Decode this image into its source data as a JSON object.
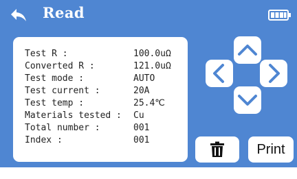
{
  "header": {
    "title": "Read",
    "back_icon": "back-arrow-icon",
    "battery_icon": "battery-full-icon"
  },
  "colors": {
    "header_bg": "#4f86d2",
    "accent": "#4f86d2",
    "panel_bg": "#ffffff",
    "text": "#222222"
  },
  "readings": [
    {
      "label": "Test R :",
      "value": "100.0uΩ"
    },
    {
      "label": "Converted R :",
      "value": "121.0uΩ"
    },
    {
      "label": "Test mode :",
      "value": "AUTO"
    },
    {
      "label": "Test current :",
      "value": "20A"
    },
    {
      "label": "Test temp :",
      "value": "25.4℃"
    },
    {
      "label": "Materials tested :",
      "value": "Cu"
    },
    {
      "label": "Total number :",
      "value": "001"
    },
    {
      "label": "Index :",
      "value": "001"
    }
  ],
  "nav": {
    "up_icon": "chevron-up-icon",
    "down_icon": "chevron-down-icon",
    "left_icon": "chevron-left-icon",
    "right_icon": "chevron-right-icon"
  },
  "actions": {
    "delete_icon": "trash-icon",
    "print_label": "Print"
  }
}
